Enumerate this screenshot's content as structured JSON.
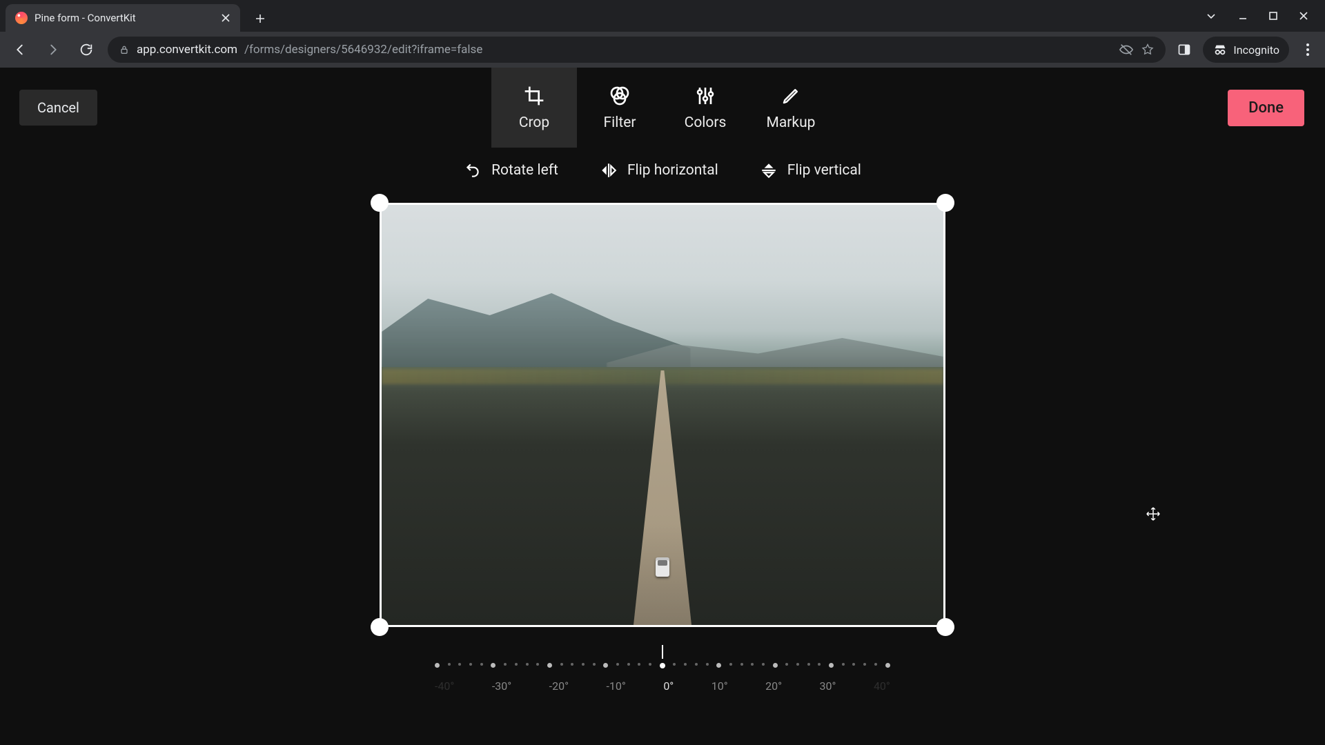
{
  "browser": {
    "tab_title": "Pine form - ConvertKit",
    "url_host": "app.convertkit.com",
    "url_path": "/forms/designers/5646932/edit?iframe=false",
    "incognito_label": "Incognito"
  },
  "editor": {
    "cancel_label": "Cancel",
    "done_label": "Done",
    "modes": {
      "crop": "Crop",
      "filter": "Filter",
      "colors": "Colors",
      "markup": "Markup"
    },
    "active_mode": "crop",
    "crop_actions": {
      "rotate_left": "Rotate left",
      "flip_horizontal": "Flip horizontal",
      "flip_vertical": "Flip vertical"
    },
    "rotation_dial": {
      "labels": [
        "-40°",
        "-30°",
        "-20°",
        "-10°",
        "0°",
        "10°",
        "20°",
        "30°",
        "40°"
      ],
      "current_value": "0°"
    }
  },
  "colors": {
    "accent": "#f8627a",
    "bg": "#0f0f0f",
    "panel": "#2b2b2b"
  }
}
